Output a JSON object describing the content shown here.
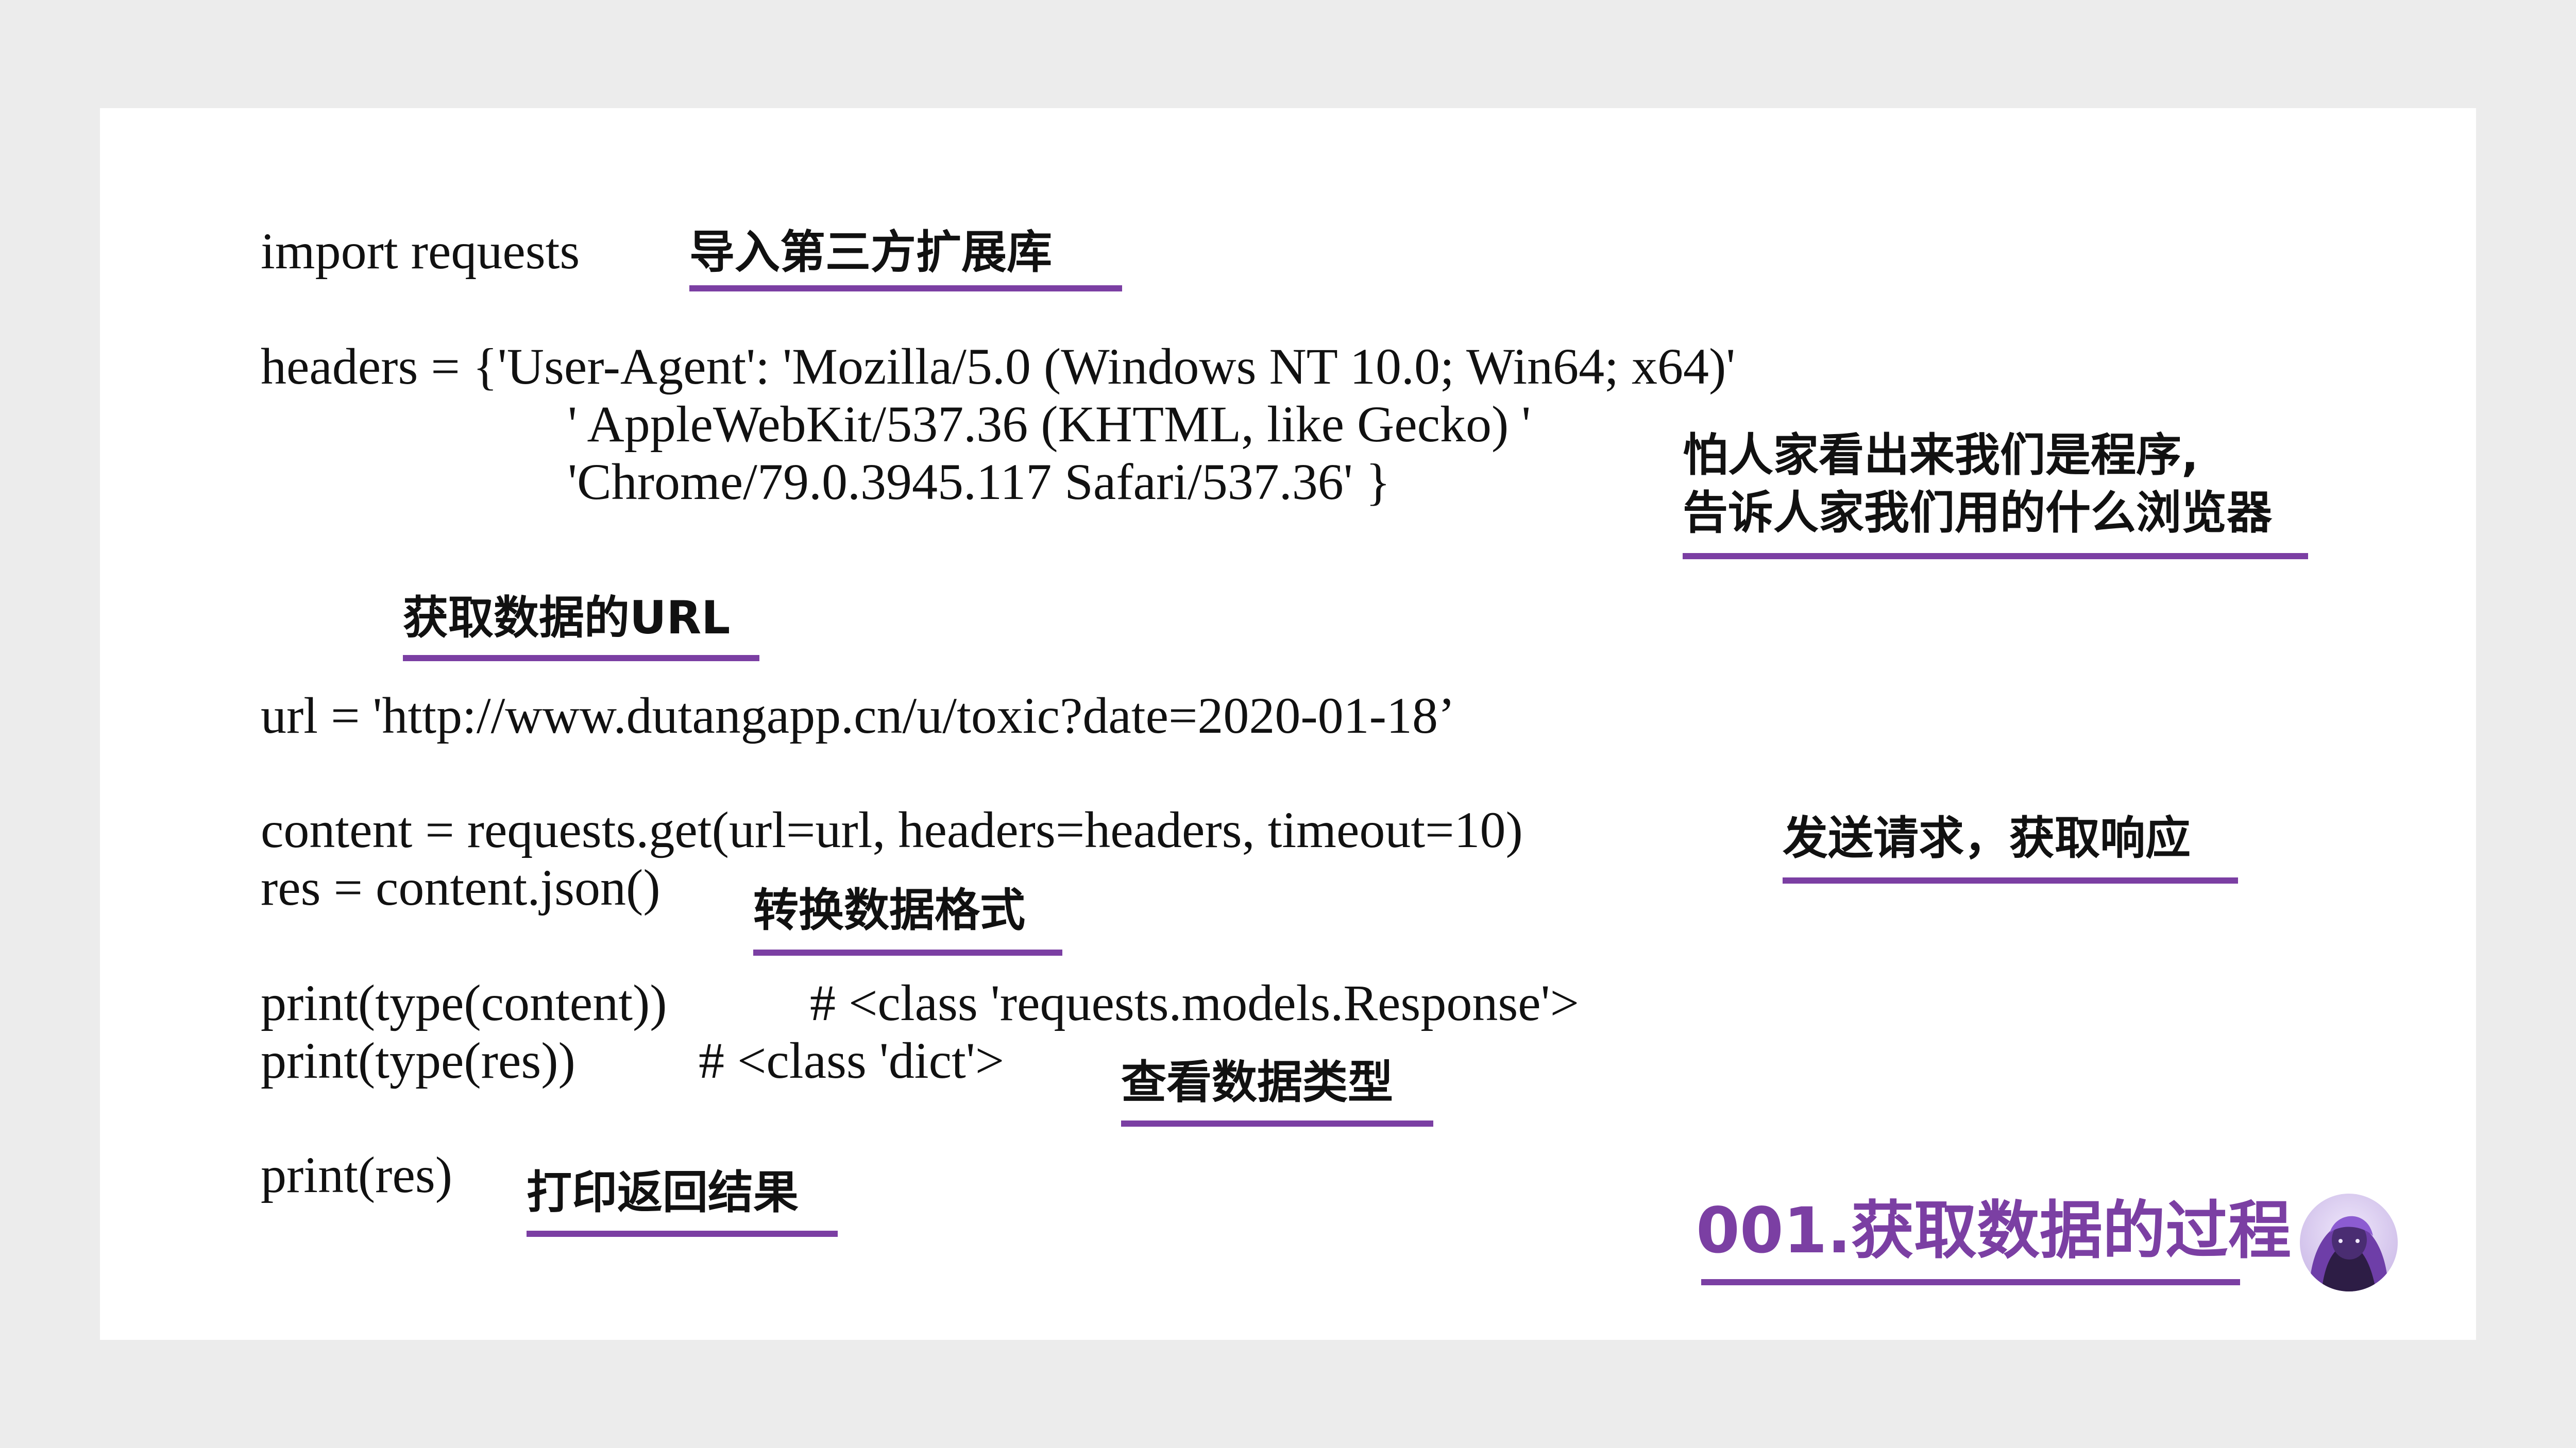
{
  "code": {
    "line_import": "import requests",
    "line_headers_1": "headers = {'User-Agent': 'Mozilla/5.0 (Windows NT 10.0; Win64; x64)'",
    "line_headers_2": "' AppleWebKit/537.36 (KHTML, like Gecko) '",
    "line_headers_3": "'Chrome/79.0.3945.117 Safari/537.36' }",
    "line_url": "url = 'http://www.dutangapp.cn/u/toxic?date=2020-01-18’",
    "line_content": "content = requests.get(url=url, headers=headers, timeout=10)",
    "line_res": "res = content.json()",
    "line_print_type_content": "print(type(content))",
    "comment_content_type": "# <class 'requests.models.Response'>",
    "line_print_type_res": "print(type(res))",
    "comment_res_type": "# <class 'dict'>",
    "line_print_res": "print(res)"
  },
  "notes": {
    "import_note": "导入第三方扩展库",
    "headers_note_line1": "怕人家看出来我们是程序,",
    "headers_note_line2": "告诉人家我们用的什么浏览器",
    "url_note": "获取数据的URL",
    "request_note": "发送请求，获取响应",
    "json_note": "转换数据格式",
    "type_note": "查看数据类型",
    "print_note": "打印返回结果"
  },
  "footer": {
    "title": "001.获取数据的过程"
  },
  "colors": {
    "accent": "#7b3fa3",
    "text": "#111111",
    "page_background": "#ececec",
    "slide_background": "#ffffff"
  },
  "icons": {
    "avatar": "author-avatar"
  }
}
